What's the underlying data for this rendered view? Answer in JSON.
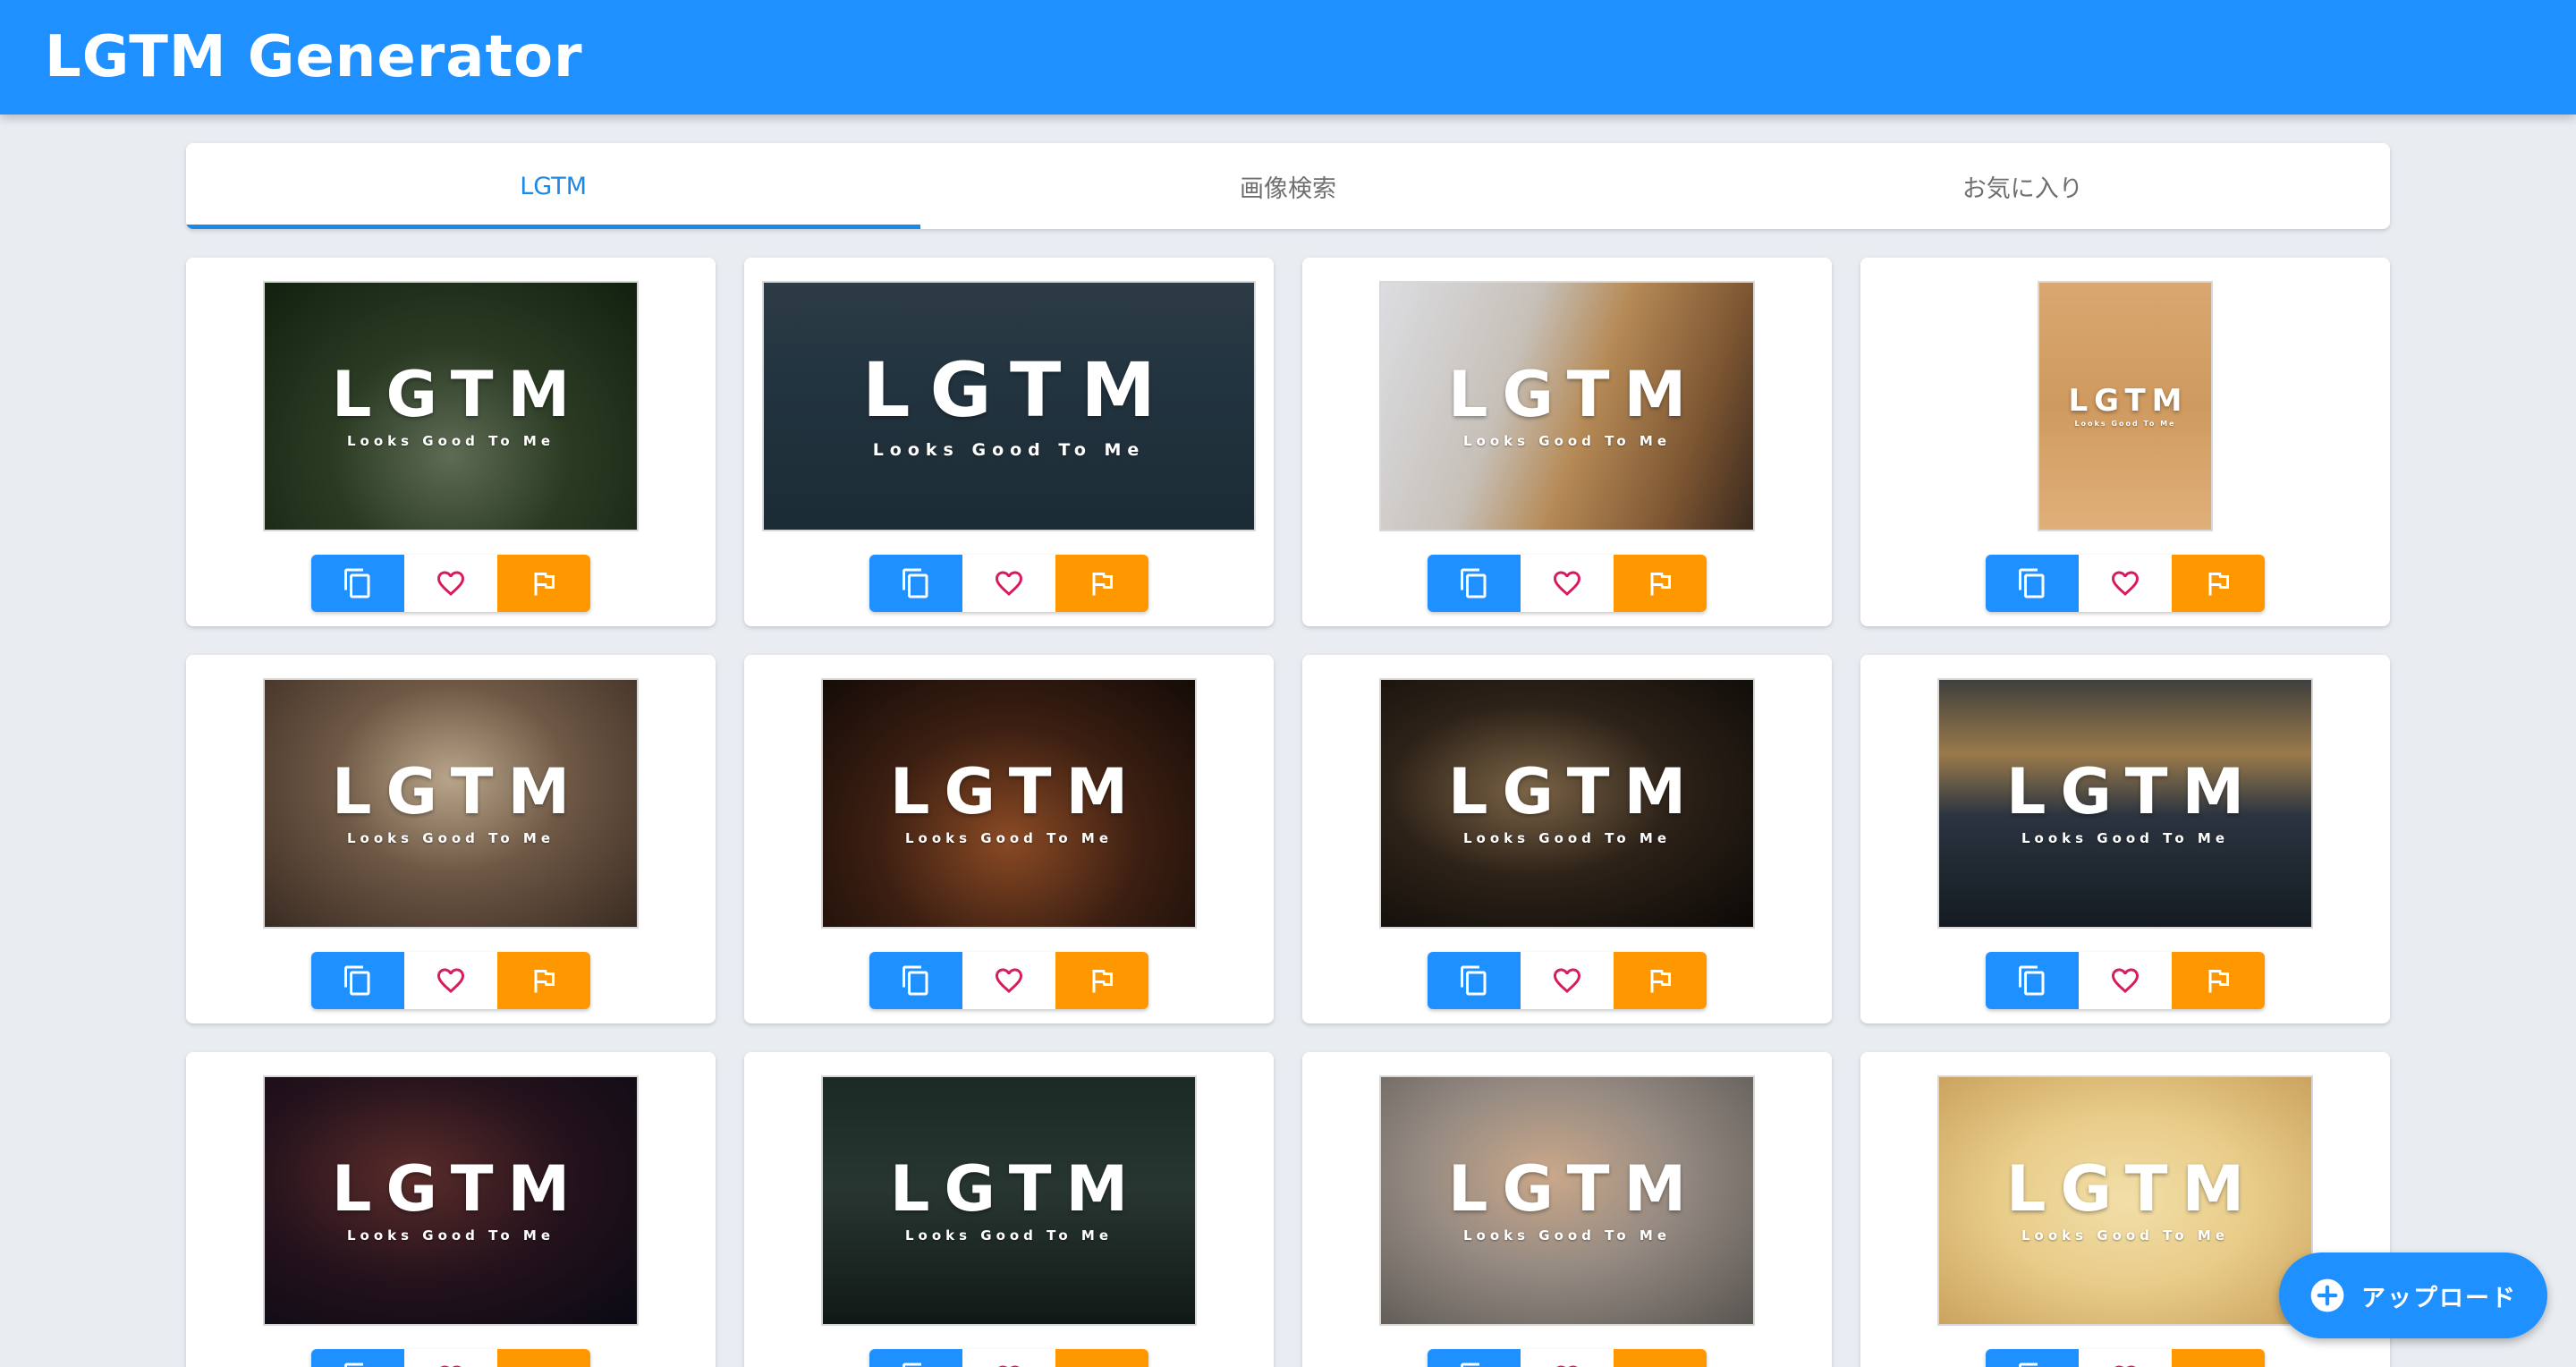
{
  "header": {
    "title": "LGTM Generator"
  },
  "tabs": [
    {
      "label": "LGTM",
      "active": true
    },
    {
      "label": "画像検索",
      "active": false
    },
    {
      "label": "お気に入り",
      "active": false
    }
  ],
  "overlay": {
    "main": "LGTM",
    "sub": "Looks Good To Me"
  },
  "cards": [
    {
      "image": "forest-path",
      "icons": [
        "copy-icon",
        "heart-icon",
        "flag-icon"
      ]
    },
    {
      "image": "ship-at-sea",
      "icons": [
        "copy-icon",
        "heart-icon",
        "flag-icon"
      ]
    },
    {
      "image": "shiba-dog",
      "icons": [
        "copy-icon",
        "heart-icon",
        "flag-icon"
      ]
    },
    {
      "image": "acoustic-guitar",
      "icons": [
        "copy-icon",
        "heart-icon",
        "flag-icon"
      ]
    },
    {
      "image": "kitten-in-blanket",
      "icons": [
        "copy-icon",
        "heart-icon",
        "flag-icon"
      ]
    },
    {
      "image": "birthday-cake",
      "icons": [
        "copy-icon",
        "heart-icon",
        "flag-icon"
      ]
    },
    {
      "image": "dog-in-dark",
      "icons": [
        "copy-icon",
        "heart-icon",
        "flag-icon"
      ]
    },
    {
      "image": "bridge-sunset",
      "icons": [
        "copy-icon",
        "heart-icon",
        "flag-icon"
      ]
    },
    {
      "image": "carnival-ride",
      "icons": [
        "copy-icon",
        "heart-icon",
        "flag-icon"
      ]
    },
    {
      "image": "dark-hall",
      "icons": [
        "copy-icon",
        "heart-icon",
        "flag-icon"
      ]
    },
    {
      "image": "shiba-with-leash",
      "icons": [
        "copy-icon",
        "heart-icon",
        "flag-icon"
      ]
    },
    {
      "image": "chicks",
      "icons": [
        "copy-icon",
        "heart-icon",
        "flag-icon"
      ]
    }
  ],
  "upload": {
    "label": "アップロード",
    "icon": "plus-circle-icon"
  },
  "colors": {
    "primary": "#1e90ff",
    "accent": "#ff9800",
    "heart": "#d81b60",
    "tab_active": "#1e88e5"
  }
}
